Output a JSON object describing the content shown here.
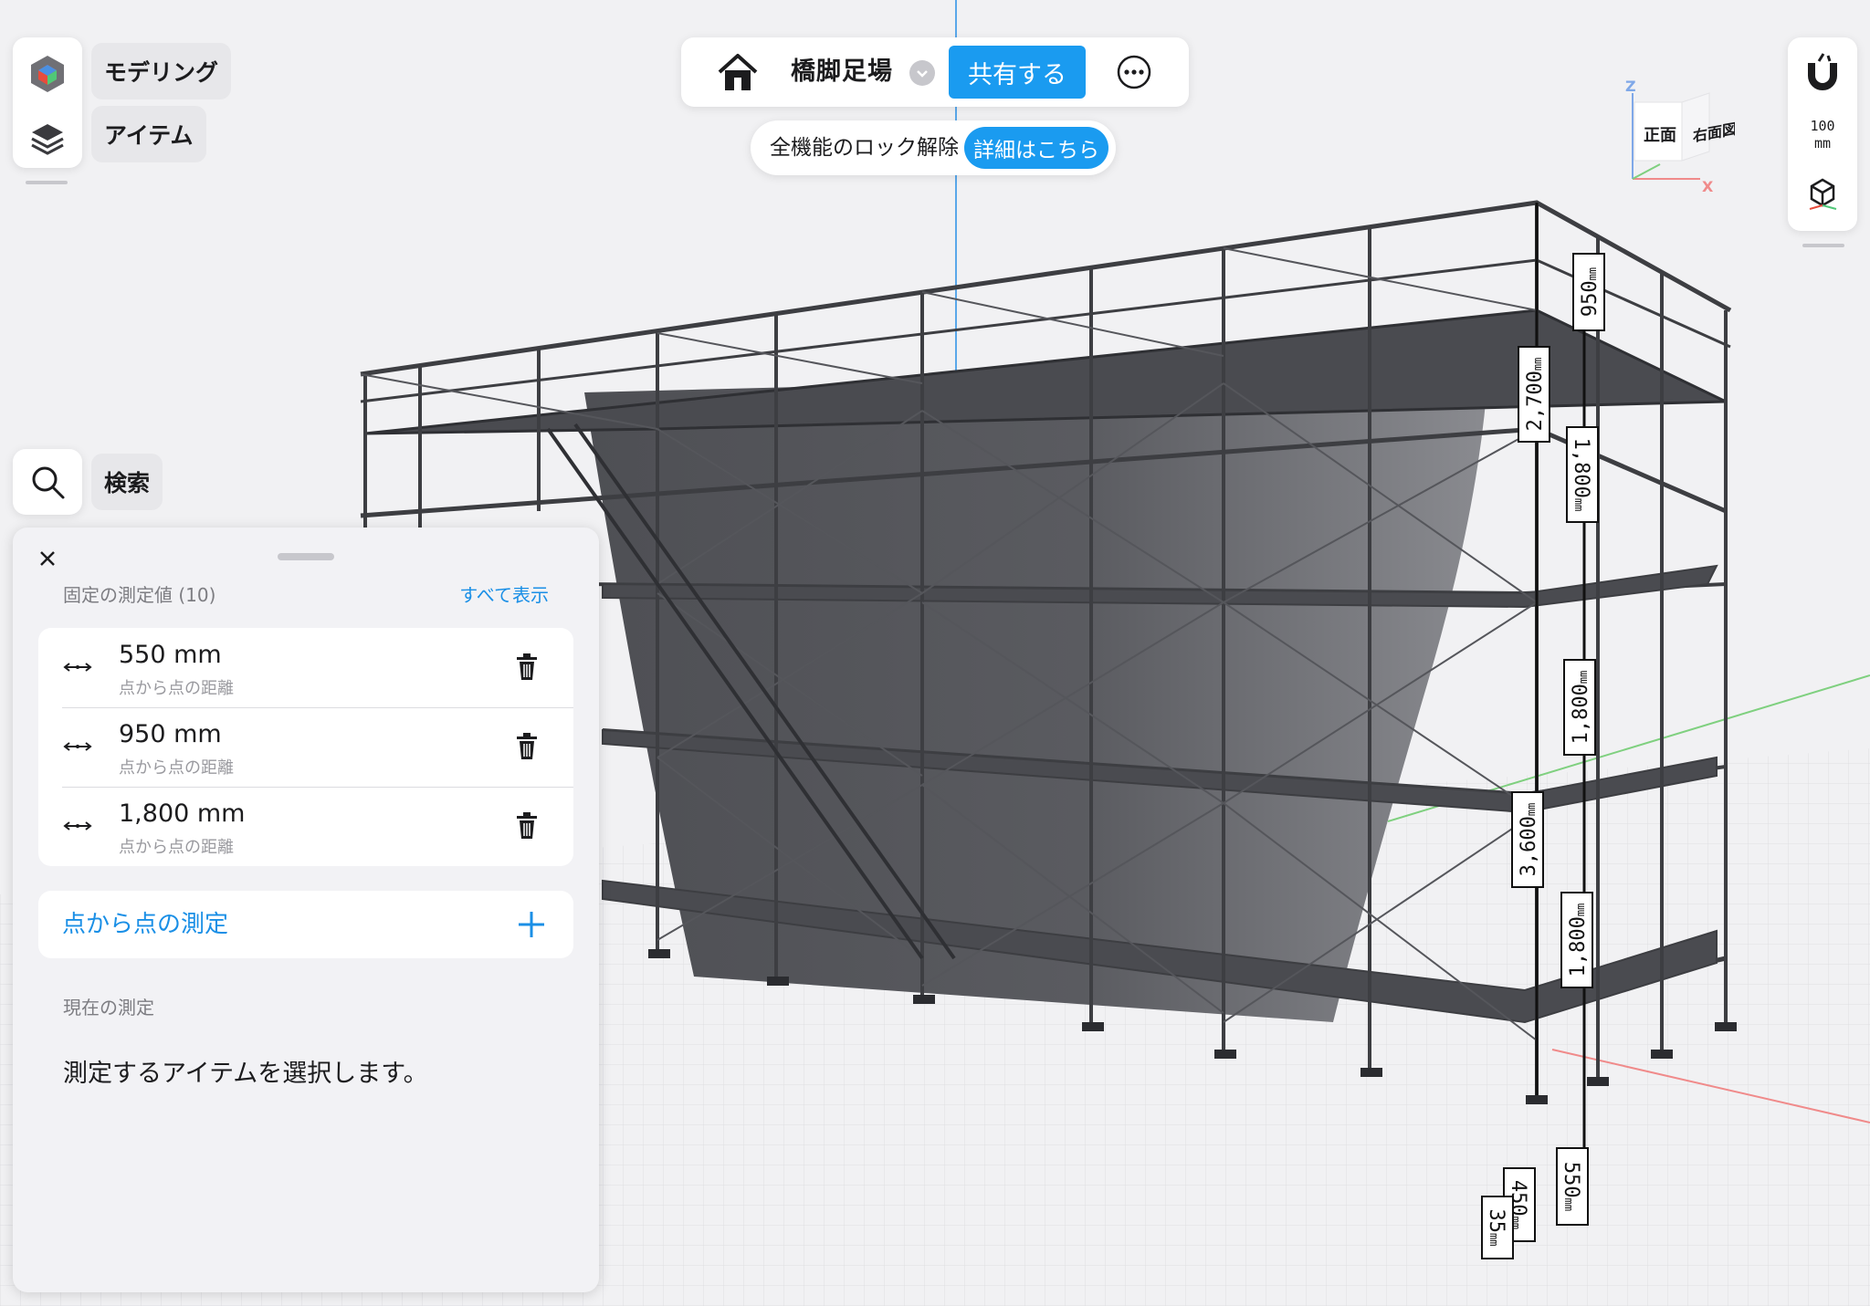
{
  "sidebar": {
    "modeling_label": "モデリング",
    "items_label": "アイテム",
    "search_label": "検索"
  },
  "top_bar": {
    "title": "橋脚足場",
    "share_label": "共有する"
  },
  "unlock_banner": {
    "text": "全機能のロック解除",
    "details_label": "詳細はこちら"
  },
  "right_tools": {
    "snap_value": "100",
    "snap_unit": "mm"
  },
  "view_cube": {
    "front_label": "正面",
    "right_label": "右面図",
    "axis_z": "Z",
    "axis_x": "X"
  },
  "panel": {
    "pinned_header": "固定の測定値 (10)",
    "show_all_label": "すべて表示",
    "measurements": [
      {
        "value": "550 mm",
        "subtitle": "点から点の距離"
      },
      {
        "value": "950 mm",
        "subtitle": "点から点の距離"
      },
      {
        "value": "1,800 mm",
        "subtitle": "点から点の距離"
      }
    ],
    "add_label": "点から点の測定",
    "current_header": "現在の測定",
    "instruction": "測定するアイテムを選択します。"
  },
  "dimension_labels": [
    {
      "value": "950",
      "unit": "mm"
    },
    {
      "value": "2,700",
      "unit": "mm"
    },
    {
      "value": "1,800",
      "unit": "mm"
    },
    {
      "value": "1,800",
      "unit": "mm"
    },
    {
      "value": "3,600",
      "unit": "mm"
    },
    {
      "value": "1,800",
      "unit": "mm"
    },
    {
      "value": "550",
      "unit": "mm"
    },
    {
      "value": "450",
      "unit": "mm"
    },
    {
      "value": "35",
      "unit": "mm"
    }
  ],
  "colors": {
    "accent": "#1a9bf0",
    "link": "#1a8fe6",
    "scaffold": "#3d3e42",
    "deck": "#4a4b50",
    "pier": "#5c5d62",
    "canvas": "#f1f1f3"
  }
}
